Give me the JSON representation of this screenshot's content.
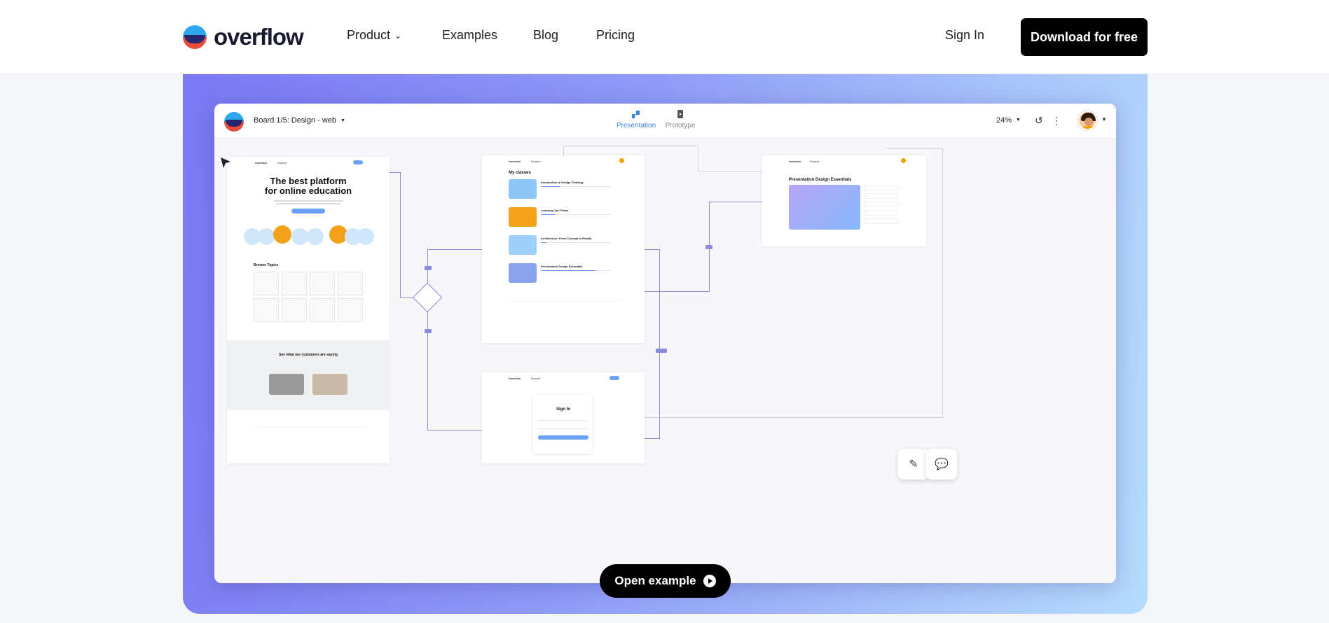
{
  "nav": {
    "logo_text": "overflow",
    "links": [
      {
        "label": "Product",
        "has_dropdown": true
      },
      {
        "label": "Examples"
      },
      {
        "label": "Blog"
      },
      {
        "label": "Pricing"
      }
    ],
    "signin_label": "Sign In",
    "download_label": "Download for free"
  },
  "board": {
    "title": "Board 1/5: Design - web",
    "tabs": [
      {
        "label": "Presentation",
        "active": true,
        "icon": "presentation-icon"
      },
      {
        "label": "Prototype",
        "active": false,
        "icon": "prototype-icon"
      }
    ],
    "zoom": "24%"
  },
  "frames": {
    "home": {
      "headline_1": "The best platform",
      "headline_2": "for online education",
      "browse_topics": "Browse Topics",
      "testimonials": "See what our customers are saying"
    },
    "classes": {
      "heading": "My classes",
      "items": [
        "Introduction to Design Thinking",
        "Learning User Flows",
        "Architecture: From Concept to Reality",
        "Presentation Design Essentials"
      ]
    },
    "course": {
      "heading": "Presentation Design Essentials"
    },
    "signin": {
      "heading": "Sign In"
    }
  },
  "cta": {
    "open_example": "Open example"
  },
  "colors": {
    "accent": "#3a82e0",
    "connector": "#8b8bde",
    "gradient_start": "#7a78f4",
    "gradient_end": "#b6dbfd"
  }
}
